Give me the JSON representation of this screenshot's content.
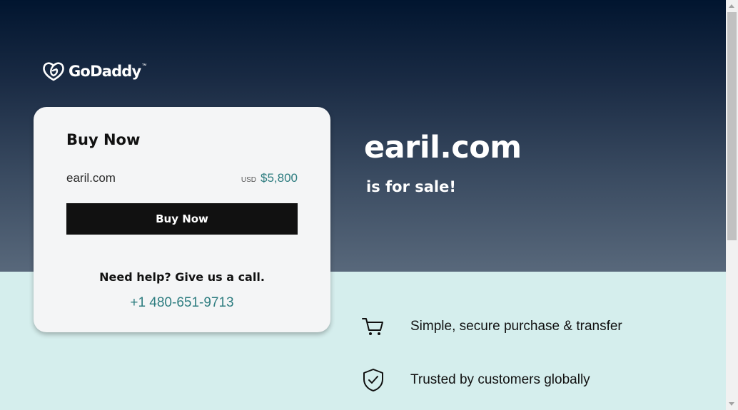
{
  "brand": {
    "name": "GoDaddy",
    "trademark": "™",
    "logo_icon": "godaddy-heart-logo"
  },
  "buy_card": {
    "title": "Buy Now",
    "domain": "earil.com",
    "currency": "USD",
    "price": "$5,800",
    "button_label": "Buy Now",
    "help_text": "Need help? Give us a call.",
    "phone": "+1 480-651-9713"
  },
  "hero": {
    "domain": "earil.com",
    "subtitle": "is for sale!"
  },
  "features": [
    {
      "icon": "cart-icon",
      "label": "Simple, secure purchase & transfer"
    },
    {
      "icon": "shield-check-icon",
      "label": "Trusted by customers globally"
    }
  ],
  "colors": {
    "hero_top": "#01152f",
    "hero_bottom": "#58687b",
    "lower_bg": "#d5eeed",
    "accent_teal": "#2e7d80",
    "button_bg": "#111111"
  }
}
